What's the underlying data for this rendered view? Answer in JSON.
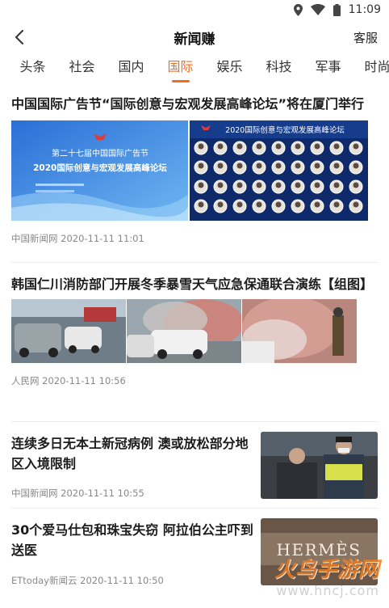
{
  "status": {
    "time": "11:09"
  },
  "header": {
    "title": "新闻赚",
    "right_label": "客服"
  },
  "tabs": [
    {
      "label": "头条",
      "active": false
    },
    {
      "label": "社会",
      "active": false
    },
    {
      "label": "国内",
      "active": false
    },
    {
      "label": "国际",
      "active": true
    },
    {
      "label": "娱乐",
      "active": false
    },
    {
      "label": "科技",
      "active": false
    },
    {
      "label": "军事",
      "active": false
    },
    {
      "label": "时尚",
      "active": false
    }
  ],
  "articles": [
    {
      "title": "中国国际广告节“国际创意与宏观发展高峰论坛”将在厦门举行",
      "source": "中国新闻网",
      "time": "2020-11-11 11:01",
      "image1_line1": "第二十七届中国国际广告节",
      "image1_line2": "2020国际创意与宏观发展高峰论坛",
      "image2_title": "2020国际创意与宏观发展高峰论坛"
    },
    {
      "title": "韩国仁川消防部门开展冬季暴雪天气应急保通联合演练【组图】",
      "source": "人民网",
      "time": "2020-11-11 10:56"
    },
    {
      "title": "连续多日无本土新冠病例 澳或放松部分地区入境限制",
      "source": "中国新闻网",
      "time": "2020-11-11 10:55"
    },
    {
      "title": "30个爱马仕包和珠宝失窃 阿拉伯公主吓到送医",
      "source": "ETtoday新闻云",
      "time": "2020-11-11 10:50",
      "image_text": "HERMÈS"
    }
  ],
  "watermark": {
    "text": "火鸟手游网",
    "url": "www.hncj.com"
  },
  "colors": {
    "accent": "#f26b22",
    "text": "#1c1c1c",
    "meta": "#888888"
  }
}
